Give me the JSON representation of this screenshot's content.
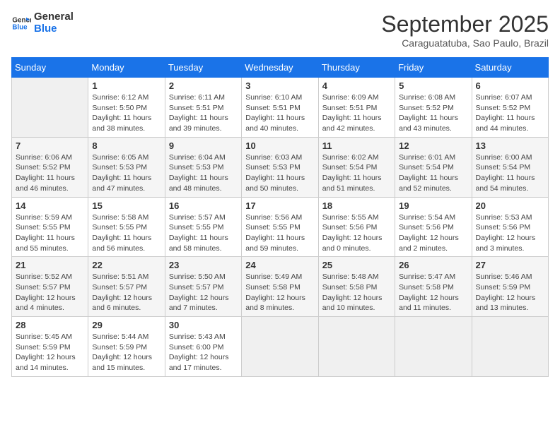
{
  "header": {
    "logo_line1": "General",
    "logo_line2": "Blue",
    "month": "September 2025",
    "location": "Caraguatatuba, Sao Paulo, Brazil"
  },
  "days_of_week": [
    "Sunday",
    "Monday",
    "Tuesday",
    "Wednesday",
    "Thursday",
    "Friday",
    "Saturday"
  ],
  "weeks": [
    [
      {
        "day": "",
        "info": ""
      },
      {
        "day": "1",
        "info": "Sunrise: 6:12 AM\nSunset: 5:50 PM\nDaylight: 11 hours\nand 38 minutes."
      },
      {
        "day": "2",
        "info": "Sunrise: 6:11 AM\nSunset: 5:51 PM\nDaylight: 11 hours\nand 39 minutes."
      },
      {
        "day": "3",
        "info": "Sunrise: 6:10 AM\nSunset: 5:51 PM\nDaylight: 11 hours\nand 40 minutes."
      },
      {
        "day": "4",
        "info": "Sunrise: 6:09 AM\nSunset: 5:51 PM\nDaylight: 11 hours\nand 42 minutes."
      },
      {
        "day": "5",
        "info": "Sunrise: 6:08 AM\nSunset: 5:52 PM\nDaylight: 11 hours\nand 43 minutes."
      },
      {
        "day": "6",
        "info": "Sunrise: 6:07 AM\nSunset: 5:52 PM\nDaylight: 11 hours\nand 44 minutes."
      }
    ],
    [
      {
        "day": "7",
        "info": "Sunrise: 6:06 AM\nSunset: 5:52 PM\nDaylight: 11 hours\nand 46 minutes."
      },
      {
        "day": "8",
        "info": "Sunrise: 6:05 AM\nSunset: 5:53 PM\nDaylight: 11 hours\nand 47 minutes."
      },
      {
        "day": "9",
        "info": "Sunrise: 6:04 AM\nSunset: 5:53 PM\nDaylight: 11 hours\nand 48 minutes."
      },
      {
        "day": "10",
        "info": "Sunrise: 6:03 AM\nSunset: 5:53 PM\nDaylight: 11 hours\nand 50 minutes."
      },
      {
        "day": "11",
        "info": "Sunrise: 6:02 AM\nSunset: 5:54 PM\nDaylight: 11 hours\nand 51 minutes."
      },
      {
        "day": "12",
        "info": "Sunrise: 6:01 AM\nSunset: 5:54 PM\nDaylight: 11 hours\nand 52 minutes."
      },
      {
        "day": "13",
        "info": "Sunrise: 6:00 AM\nSunset: 5:54 PM\nDaylight: 11 hours\nand 54 minutes."
      }
    ],
    [
      {
        "day": "14",
        "info": "Sunrise: 5:59 AM\nSunset: 5:55 PM\nDaylight: 11 hours\nand 55 minutes."
      },
      {
        "day": "15",
        "info": "Sunrise: 5:58 AM\nSunset: 5:55 PM\nDaylight: 11 hours\nand 56 minutes."
      },
      {
        "day": "16",
        "info": "Sunrise: 5:57 AM\nSunset: 5:55 PM\nDaylight: 11 hours\nand 58 minutes."
      },
      {
        "day": "17",
        "info": "Sunrise: 5:56 AM\nSunset: 5:55 PM\nDaylight: 11 hours\nand 59 minutes."
      },
      {
        "day": "18",
        "info": "Sunrise: 5:55 AM\nSunset: 5:56 PM\nDaylight: 12 hours\nand 0 minutes."
      },
      {
        "day": "19",
        "info": "Sunrise: 5:54 AM\nSunset: 5:56 PM\nDaylight: 12 hours\nand 2 minutes."
      },
      {
        "day": "20",
        "info": "Sunrise: 5:53 AM\nSunset: 5:56 PM\nDaylight: 12 hours\nand 3 minutes."
      }
    ],
    [
      {
        "day": "21",
        "info": "Sunrise: 5:52 AM\nSunset: 5:57 PM\nDaylight: 12 hours\nand 4 minutes."
      },
      {
        "day": "22",
        "info": "Sunrise: 5:51 AM\nSunset: 5:57 PM\nDaylight: 12 hours\nand 6 minutes."
      },
      {
        "day": "23",
        "info": "Sunrise: 5:50 AM\nSunset: 5:57 PM\nDaylight: 12 hours\nand 7 minutes."
      },
      {
        "day": "24",
        "info": "Sunrise: 5:49 AM\nSunset: 5:58 PM\nDaylight: 12 hours\nand 8 minutes."
      },
      {
        "day": "25",
        "info": "Sunrise: 5:48 AM\nSunset: 5:58 PM\nDaylight: 12 hours\nand 10 minutes."
      },
      {
        "day": "26",
        "info": "Sunrise: 5:47 AM\nSunset: 5:58 PM\nDaylight: 12 hours\nand 11 minutes."
      },
      {
        "day": "27",
        "info": "Sunrise: 5:46 AM\nSunset: 5:59 PM\nDaylight: 12 hours\nand 13 minutes."
      }
    ],
    [
      {
        "day": "28",
        "info": "Sunrise: 5:45 AM\nSunset: 5:59 PM\nDaylight: 12 hours\nand 14 minutes."
      },
      {
        "day": "29",
        "info": "Sunrise: 5:44 AM\nSunset: 5:59 PM\nDaylight: 12 hours\nand 15 minutes."
      },
      {
        "day": "30",
        "info": "Sunrise: 5:43 AM\nSunset: 6:00 PM\nDaylight: 12 hours\nand 17 minutes."
      },
      {
        "day": "",
        "info": ""
      },
      {
        "day": "",
        "info": ""
      },
      {
        "day": "",
        "info": ""
      },
      {
        "day": "",
        "info": ""
      }
    ]
  ]
}
